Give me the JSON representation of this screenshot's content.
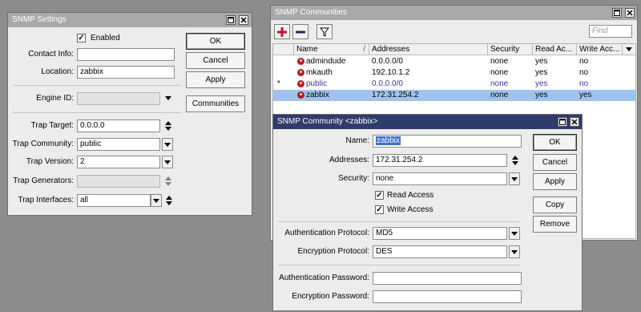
{
  "snmp_settings": {
    "title": "SNMP Settings",
    "enabled_label": "Enabled",
    "enabled_checked": true,
    "contact_info_label": "Contact Info:",
    "contact_info_value": "",
    "location_label": "Location:",
    "location_value": "zabbix",
    "engine_id_label": "Engine ID:",
    "engine_id_value": "",
    "trap_target_label": "Trap Target:",
    "trap_target_value": "0.0.0.0",
    "trap_community_label": "Trap Community:",
    "trap_community_value": "public",
    "trap_version_label": "Trap Version:",
    "trap_version_value": "2",
    "trap_generators_label": "Trap Generators:",
    "trap_generators_value": "",
    "trap_interfaces_label": "Trap Interfaces:",
    "trap_interfaces_value": "all",
    "ok_label": "OK",
    "cancel_label": "Cancel",
    "apply_label": "Apply",
    "communities_label": "Communities"
  },
  "snmp_communities": {
    "title": "SNMP Communities",
    "find_placeholder": "Find",
    "columns": [
      "Name",
      "Addresses",
      "Security",
      "Read Ac...",
      "Write Acc..."
    ],
    "sort_indicator": "/",
    "rows": [
      {
        "marker": "",
        "name": "admindude",
        "addresses": "0.0.0.0/0",
        "security": "none",
        "read": "yes",
        "write": "no",
        "selected": false,
        "dim": false
      },
      {
        "marker": "",
        "name": "mkauth",
        "addresses": "192.10.1.2",
        "security": "none",
        "read": "yes",
        "write": "no",
        "selected": false,
        "dim": false
      },
      {
        "marker": "*",
        "name": "public",
        "addresses": "0.0.0.0/0",
        "security": "none",
        "read": "yes",
        "write": "no",
        "selected": false,
        "dim": true
      },
      {
        "marker": "",
        "name": "zabbix",
        "addresses": "172.31.254.2",
        "security": "none",
        "read": "yes",
        "write": "yes",
        "selected": true,
        "dim": false
      }
    ]
  },
  "snmp_community": {
    "title": "SNMP Community <zabbix>",
    "name_label": "Name:",
    "name_value": "zabbix",
    "addresses_label": "Addresses:",
    "addresses_value": "172.31.254.2",
    "security_label": "Security:",
    "security_value": "none",
    "read_access_label": "Read Access",
    "read_access_checked": true,
    "write_access_label": "Write Access",
    "write_access_checked": true,
    "auth_protocol_label": "Authentication Protocol:",
    "auth_protocol_value": "MD5",
    "enc_protocol_label": "Encryption Protocol:",
    "enc_protocol_value": "DES",
    "auth_password_label": "Authentication Password:",
    "auth_password_value": "",
    "enc_password_label": "Encryption Password:",
    "enc_password_value": "",
    "ok_label": "OK",
    "cancel_label": "Cancel",
    "apply_label": "Apply",
    "copy_label": "Copy",
    "remove_label": "Remove"
  },
  "colors": {
    "desktop": "#8c8c8c",
    "inactive_title": "#a9a9a9",
    "active_title": "#2e3b6b",
    "selected_row": "#9fc3ee",
    "add_icon": "#c8102e"
  },
  "icons": {
    "add": "plus-icon",
    "remove": "minus-icon",
    "filter": "filter-icon",
    "restore": "restore-icon",
    "close": "close-icon",
    "user": "user-icon"
  }
}
